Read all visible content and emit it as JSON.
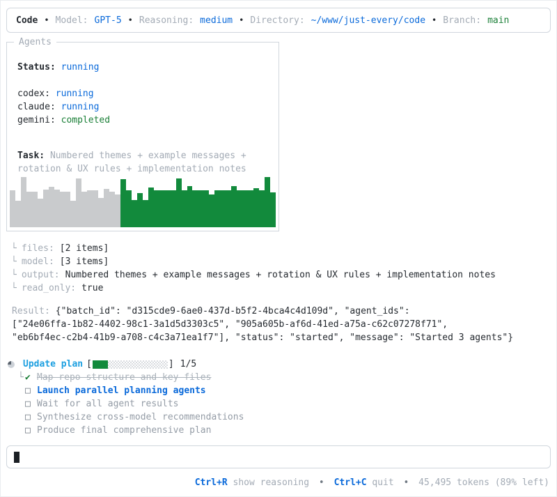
{
  "colors": {
    "dark": "#24292f",
    "gray": "#a3abb5",
    "gray2": "#949ca6",
    "blue": "#0969da",
    "cyan": "#1c9fe0",
    "green": "#1a7f37",
    "bar_past": "#c9cbcd",
    "bar_recent": "#128a3c",
    "border": "#d0d6dd",
    "strike": "#aab2ba",
    "cursor": "#1b1f24",
    "check_dark": "#6e7781"
  },
  "glyphs": {
    "bullet": "•",
    "tree": "└",
    "check": "✔",
    "box": "□",
    "open_bracket": "[",
    "close_bracket": "]"
  },
  "header": {
    "app": "Code",
    "model_label": "Model:",
    "model": "GPT-5",
    "reasoning_label": "Reasoning:",
    "reasoning": "medium",
    "directory_label": "Directory:",
    "directory": "~/www/just-every/code",
    "branch_label": "Branch:",
    "branch": "main"
  },
  "agents_panel": {
    "title": "Agents",
    "status_label": "Status:",
    "status": "running",
    "agents": [
      {
        "name": "codex:",
        "state": "running",
        "state_color": "blue"
      },
      {
        "name": "claude:",
        "state": "running",
        "state_color": "blue"
      },
      {
        "name": "gemini:",
        "state": "completed",
        "state_color": "green"
      }
    ],
    "task_label": "Task:",
    "task": "Numbered themes + example messages + rotation & UX rules + implementation notes",
    "chart_data": {
      "type": "bar",
      "title": "agent activity sparkline",
      "unit": "relative height %",
      "split_index": 20,
      "color_past": "#c9cbcd",
      "color_recent": "#128a3c",
      "values": [
        72,
        52,
        98,
        70,
        70,
        56,
        74,
        80,
        74,
        70,
        70,
        52,
        96,
        70,
        72,
        72,
        58,
        76,
        70,
        64,
        95,
        72,
        54,
        67,
        54,
        78,
        72,
        72,
        72,
        72,
        96,
        72,
        81,
        72,
        72,
        72,
        65,
        72,
        72,
        72,
        81,
        72,
        72,
        72,
        77,
        72,
        98,
        68
      ]
    }
  },
  "args": {
    "rows": [
      {
        "key": "files:",
        "value": "[2 items]"
      },
      {
        "key": "model:",
        "value": "[3 items]"
      },
      {
        "key": "output:",
        "value": "Numbered themes + example messages + rotation & UX rules + implementation notes"
      },
      {
        "key": "read_only:",
        "value": "true"
      }
    ]
  },
  "result": {
    "label": "Result:",
    "line1": "{\"batch_id\": \"d315cde9-6ae0-437d-b5f2-4bca4c4d109d\", \"agent_ids\":",
    "line2": "[\"24e06ffa-1b82-4402-98c1-3a1d5d3303c5\", \"905a605b-af6d-41ed-a75a-c62c07278f71\",",
    "line3": "\"eb6bf4ec-c2b4-41b9-a708-c4c3a71ea1f7\"], \"status\": \"started\", \"message\": \"Started 3 agents\"}"
  },
  "plan": {
    "title": "Update plan",
    "progress": {
      "current": 1,
      "total": 5,
      "label": "1/5"
    },
    "items": [
      {
        "text": "Map repo structure and key files",
        "state": "done"
      },
      {
        "text": "Launch parallel planning agents",
        "state": "active"
      },
      {
        "text": "Wait for all agent results",
        "state": "pending"
      },
      {
        "text": "Synthesize cross-model recommendations",
        "state": "pending"
      },
      {
        "text": "Produce final comprehensive plan",
        "state": "pending"
      }
    ]
  },
  "input": {
    "value": ""
  },
  "footer": {
    "hint1_key": "Ctrl+R",
    "hint1_label": "show reasoning",
    "hint2_key": "Ctrl+C",
    "hint2_label": "quit",
    "tokens": "45,495 tokens (89% left)"
  }
}
